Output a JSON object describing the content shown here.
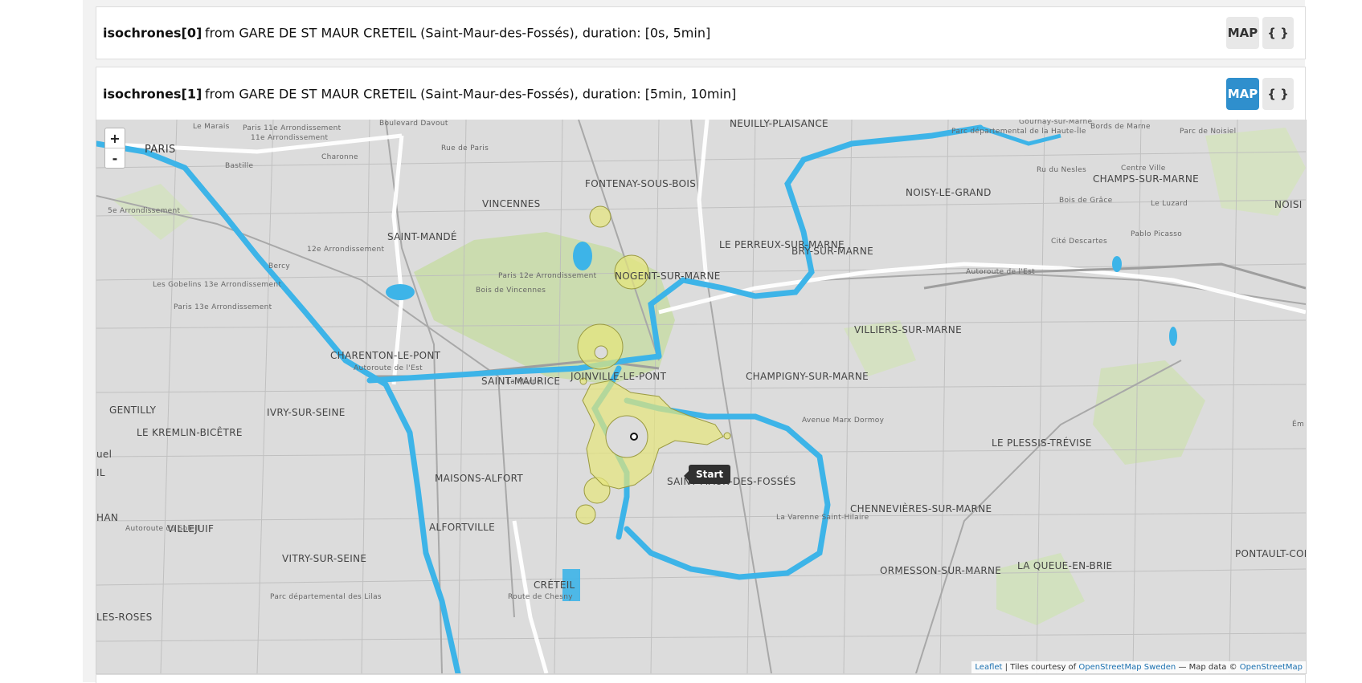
{
  "isochrones": [
    {
      "label": "isochrones[0]",
      "description": "from GARE DE ST MAUR CRETEIL (Saint-Maur-des-Fossés), duration: [0s, 5min]",
      "map_button": "MAP",
      "json_button": "{ }",
      "map_active": false
    },
    {
      "label": "isochrones[1]",
      "description": "from GARE DE ST MAUR CRETEIL (Saint-Maur-des-Fossés), duration: [5min, 10min]",
      "map_button": "MAP",
      "json_button": "{ }",
      "map_active": true
    }
  ],
  "map": {
    "zoom_in": "+",
    "zoom_out": "-",
    "marker_tooltip": "Start",
    "attribution": {
      "leaflet": "Leaflet",
      "tiles_text": " | Tiles courtesy of ",
      "tiles_link": "OpenStreetMap Sweden",
      "data_text": " — Map data © ",
      "data_link": "OpenStreetMap"
    },
    "place_labels": {
      "paris": "PARIS",
      "neuilly": "NEUILLY-PLAISANCE",
      "fontenay": "FONTENAY-SOUS-BOIS",
      "vincennes": "VINCENNES",
      "saint_mande": "SAINT-MANDÉ",
      "nogent": "NOGENT-SUR-MARNE",
      "perreux": "LE PERREUX-SUR-MARNE",
      "bry": "BRY-SUR-MARNE",
      "noisy": "NOISY-LE-GRAND",
      "champs": "CHAMPS-SUR-MARNE",
      "noisi": "NOISI",
      "villiers": "VILLIERS-SUR-MARNE",
      "charenton": "CHARENTON-LE-PONT",
      "saint_maurice": "SAINT-MAURICE",
      "joinville": "JOINVILLE-LE-PONT",
      "champigny": "CHAMPIGNY-SUR-MARNE",
      "gentilly": "GENTILLY",
      "ivry": "IVRY-SUR-SEINE",
      "kremlin": "LE KREMLIN-BICÊTRE",
      "maisons": "MAISONS-ALFORT",
      "saint_maur": "SAINT-MAUR-DES-FOSSÉS",
      "plessis": "LE PLESSIS-TRÉVISE",
      "chennevieres": "CHENNEVIÈRES-SUR-MARNE",
      "villejuif": "VILLEJUIF",
      "alfortville": "ALFORTVILLE",
      "vitry": "VITRY-SUR-SEINE",
      "creteil": "CRÉTEIL",
      "ormesson": "ORMESSON-SUR-MARNE",
      "queue": "LA QUEUE-EN-BRIE",
      "pontault": "PONTAULT-COM",
      "roses": "LES-ROSES",
      "han": "HAN",
      "uel": "uel",
      "il": "IL"
    },
    "small_labels": {
      "rue_paris": "Rue de Paris",
      "bd_davout": "Boulevard Davout",
      "le_marais": "Le Marais",
      "paris11": "Paris 11e Arrondissement",
      "arr11": "11e Arrondissement",
      "charonne": "Charonne",
      "paris12": "Paris 12e Arrondissement",
      "arr12": "12e Arrondissement",
      "bois_vincennes": "Bois de Vincennes",
      "bercy": "Bercy",
      "gobelins": "Les Gobelins 13e Arrondissement",
      "paris13": "Paris 13e Arrondissement",
      "arr5": "5e Arrondissement",
      "bastille": "Bastille",
      "autoroute_est": "Autoroute de l'Est",
      "autoroute_est2": "Autoroute de l'Est",
      "la_marne": "La Marne",
      "av_dormoy": "Avenue Marx Dormoy",
      "la_varenne": "La Varenne Saint-Hilaire",
      "route_chesny": "Route de Chesny",
      "autoroute_soleil": "Autoroute du Soleil",
      "parc_lilas": "Parc départemental des Lilas",
      "gournay": "Gournay-sur-Marne",
      "bords_marne": "Bords de Marne",
      "parc_haute_ile": "Parc départemental de la Haute-Île",
      "parc_noisiel": "Parc de Noisiel",
      "ru_nesles": "Ru du Nesles",
      "centre_ville": "Centre Ville",
      "bois_grace": "Bois de Grâce",
      "le_luzard": "Le Luzard",
      "cite_descartes": "Cité Descartes",
      "pablo_picasso": "Pablo Picasso",
      "emerain": "Ém"
    }
  }
}
